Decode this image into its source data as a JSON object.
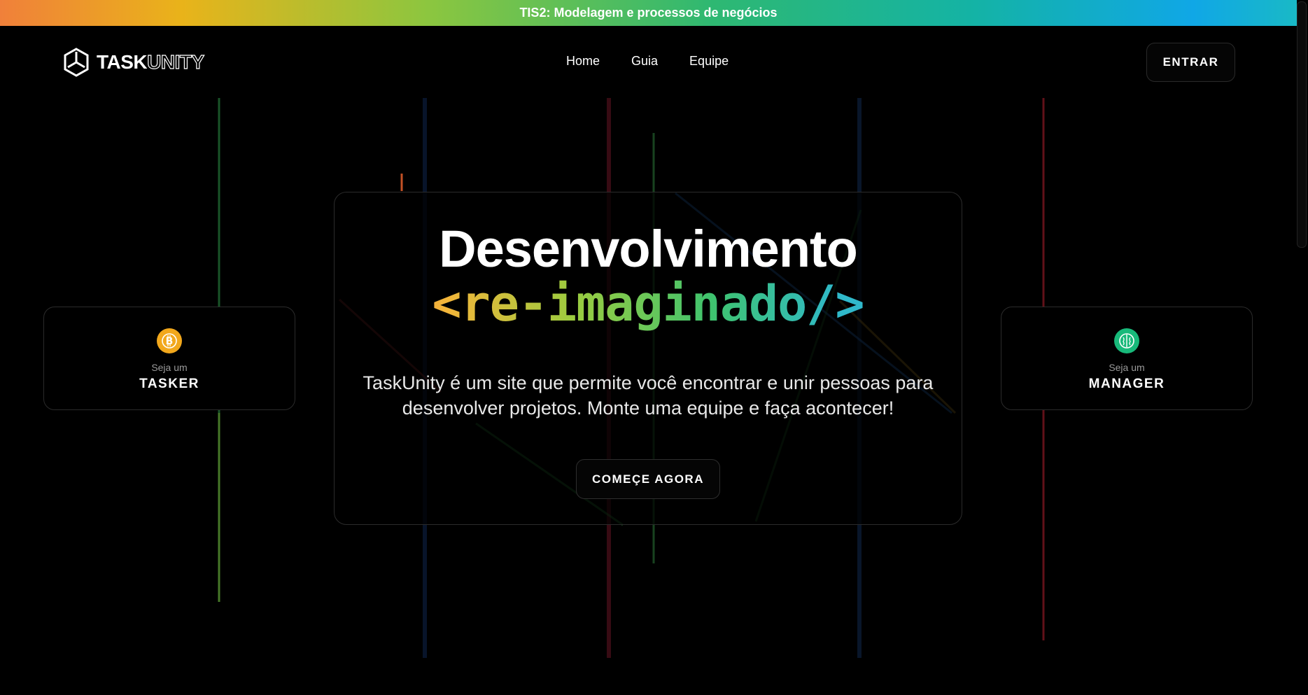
{
  "banner": {
    "text": "TIS2: Modelagem e processos de negócios"
  },
  "logo": {
    "part1": "TASK",
    "part2": "UNITY"
  },
  "nav": {
    "items": [
      "Home",
      "Guia",
      "Equipe"
    ]
  },
  "header": {
    "login_label": "ENTRAR"
  },
  "hero": {
    "title": "Desenvolvimento",
    "code_line": "<re-imaginado/>",
    "description": "TaskUnity é um site que permite você encontrar e unir pessoas para desenvolver projetos. Monte uma equipe e faça acontecer!",
    "cta_label": "COMEÇE AGORA"
  },
  "roles": {
    "tasker": {
      "subtitle": "Seja um",
      "title": "TASKER",
      "icon": "bitcoin-icon",
      "color": "#f2a81c"
    },
    "manager": {
      "subtitle": "Seja um",
      "title": "MANAGER",
      "icon": "brain-icon",
      "color": "#18b97a"
    }
  },
  "colors": {
    "gradient": [
      "#f0803a",
      "#e9b31a",
      "#8cc63f",
      "#2eb872",
      "#14b3a5",
      "#10a7e6"
    ],
    "background": "#000000"
  }
}
